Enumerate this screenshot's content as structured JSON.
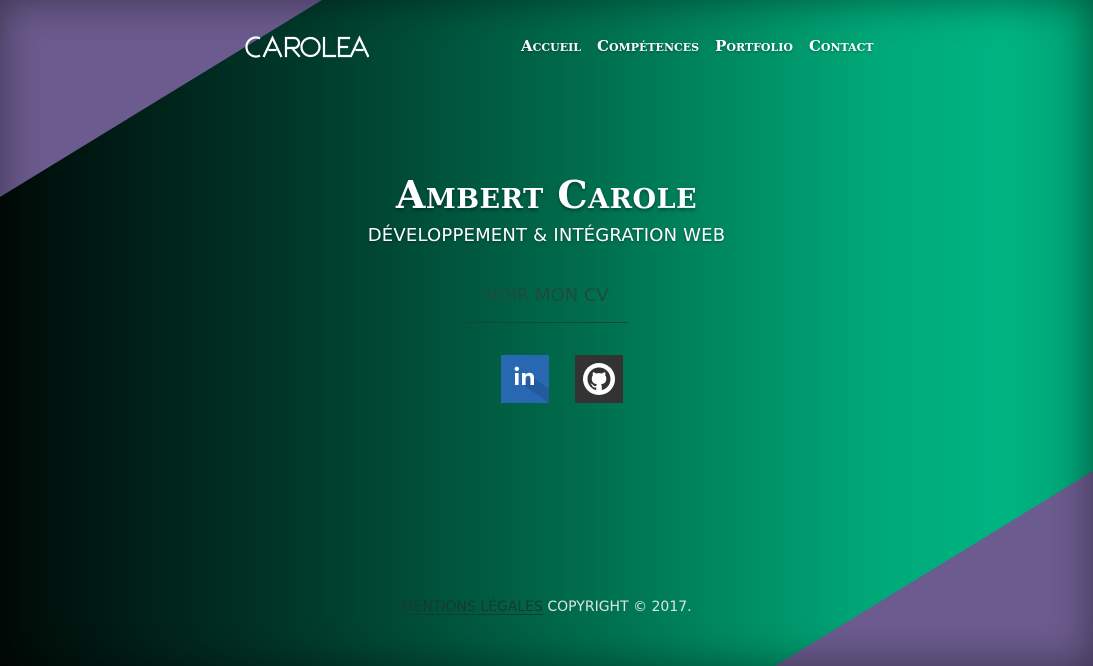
{
  "brand": {
    "logo_text": "CAROLEA"
  },
  "nav": {
    "items": [
      {
        "label": "Accueil"
      },
      {
        "label": "Compétences"
      },
      {
        "label": "Portfolio"
      },
      {
        "label": "Contact"
      }
    ]
  },
  "hero": {
    "name": "Ambert Carole",
    "subtitle": "Développement & intégration web",
    "cv_label": "Voir mon CV"
  },
  "social": {
    "linkedin_icon": "linkedin-icon",
    "github_icon": "github-icon"
  },
  "footer": {
    "legal_label": "Mentions légales",
    "copyright": "Copyright © 2017."
  },
  "colors": {
    "accent_purple": "#6b5b8e",
    "green_light": "#00b482",
    "green_dark": "#003a2b",
    "linkedin_blue": "#2867b2",
    "github_dark": "#333333"
  }
}
